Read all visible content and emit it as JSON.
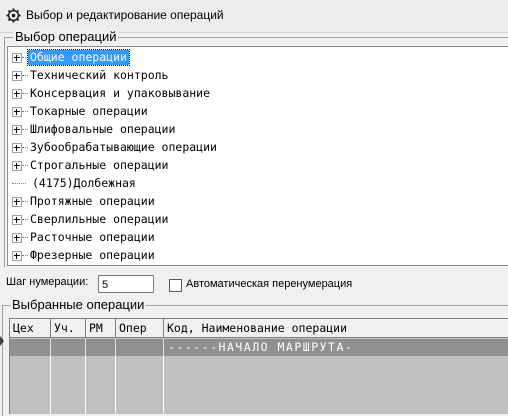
{
  "window": {
    "title": "Выбор и редактирование операций",
    "icon": "gear-icon"
  },
  "operations_group": {
    "label": "Выбор операций"
  },
  "tree": {
    "items": [
      {
        "label": "Общие операции",
        "expandable": true,
        "selected": true
      },
      {
        "label": "Технический контроль",
        "expandable": true
      },
      {
        "label": "Консервация и упаковывание",
        "expandable": true
      },
      {
        "label": "Токарные операции",
        "expandable": true
      },
      {
        "label": "Шлифовальные операции",
        "expandable": true
      },
      {
        "label": "Зубообрабатывающие операции",
        "expandable": true
      },
      {
        "label": "Строгальные операции",
        "expandable": true
      },
      {
        "label": "(4175)Долбежная",
        "expandable": false
      },
      {
        "label": "Протяжные операции",
        "expandable": true
      },
      {
        "label": "Сверлильные операции",
        "expandable": true
      },
      {
        "label": "Расточные операции",
        "expandable": true
      },
      {
        "label": "Фрезерные операции",
        "expandable": true
      }
    ]
  },
  "numbering": {
    "label": "Шаг нумерации:",
    "value": "5",
    "auto_label": "Автоматическая перенумерация",
    "auto_checked": false
  },
  "selected_group": {
    "label": "Выбранные операции"
  },
  "table": {
    "headers": [
      "Цех",
      "Уч.",
      "РМ",
      "Опер",
      "Код,  Наименование операции"
    ],
    "rows": [
      {
        "cells": [
          "",
          "",
          "",
          "",
          "------НАЧАЛО МАРШРУТА-"
        ]
      }
    ]
  }
}
